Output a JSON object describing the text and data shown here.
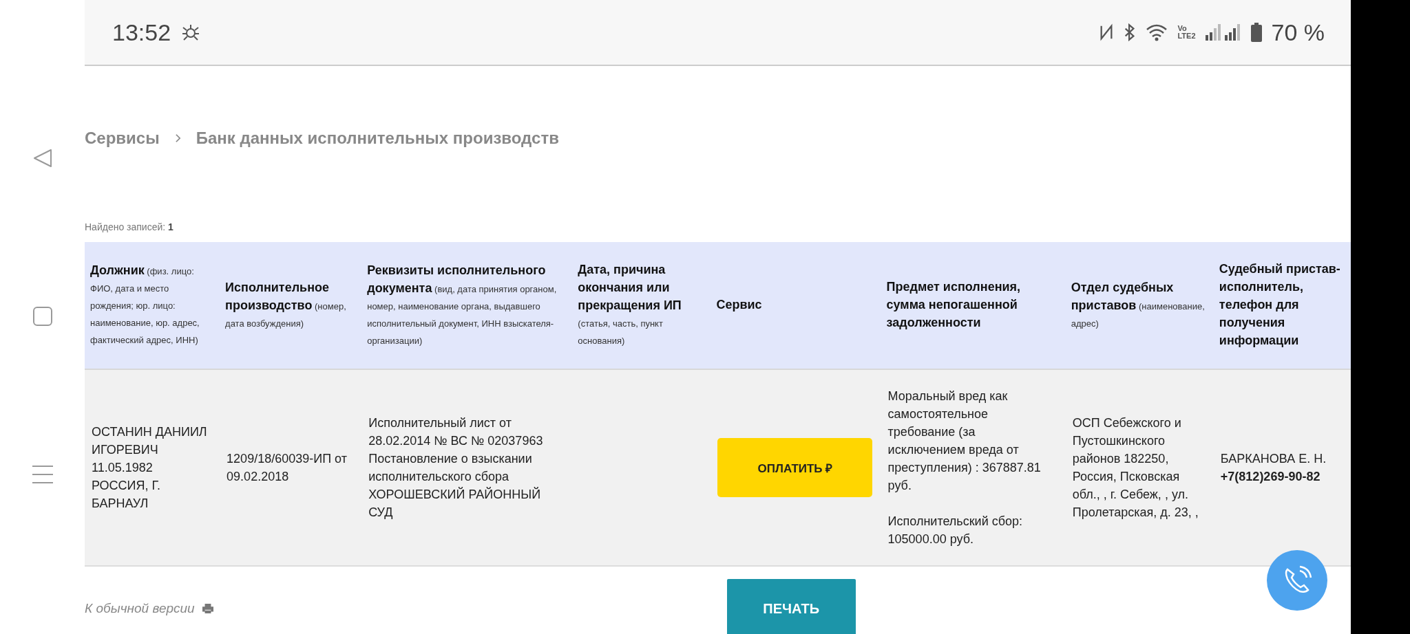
{
  "status_bar": {
    "time": "13:52",
    "volte": [
      "Vo",
      "LTE2"
    ],
    "battery": "70 %"
  },
  "breadcrumbs": [
    {
      "label": "Сервисы"
    },
    {
      "label": "Банк данных исполнительных производств"
    }
  ],
  "records_found": {
    "label": "Найдено записей:",
    "count": "1"
  },
  "table": {
    "columns": [
      {
        "header": "**Должник** (физ. лицо: ФИО, дата и место рождения; юр. лицо: наименование, юр. адрес, фактический адрес, ИНН)"
      },
      {
        "header": "**Исполнительное производство** (номер, дата возбуждения)"
      },
      {
        "header": "**Реквизиты исполнительного документа** (вид, дата принятия органом, номер, наименование органа, выдавшего исполнительный документ, ИНН взыскателя-организации)"
      },
      {
        "header": "**Дата, причина окончания или прекращения ИП** (статья, часть, пункт основания)"
      },
      {
        "header": "**Сервис**"
      },
      {
        "header": "**Предмет исполнения, сумма непогашенной задолженности**"
      },
      {
        "header": "**Отдел судебных приставов** (наименование, адрес)"
      },
      {
        "header": "**Судебный пристав-исполнитель, телефон для получения информации**"
      }
    ],
    "rows": [
      {
        "cells": [
          {
            "kind": "text",
            "paragraphs": [
              "ОСТАНИН ДАНИИЛ ИГОРЕВИЧ 11.05.1982 РОССИЯ, Г. БАРНАУЛ"
            ]
          },
          {
            "kind": "text",
            "paragraphs": [
              "1209/18/60039-ИП от 09.02.2018"
            ]
          },
          {
            "kind": "text",
            "paragraphs": [
              "Исполнительный лист от 28.02.2014 № ВС № 02037963 Постановление о взыскании исполнительского сбора ХОРОШЕВСКИЙ РАЙОННЫЙ СУД"
            ]
          },
          {
            "kind": "empty"
          },
          {
            "kind": "button",
            "label": "ОПЛАТИТЬ ₽"
          },
          {
            "kind": "text",
            "paragraphs": [
              "Моральный вред как самостоятельное требование (за исключением вреда от преступления) : 367887.81 руб.",
              "Исполнительский сбор: 105000.00 руб."
            ]
          },
          {
            "kind": "text",
            "paragraphs": [
              "ОСП Себежского и Пустошкинского районов 182250, Россия, Псковская обл., , г. Себеж, , ул. Пролетарская, д. 23, ,"
            ]
          },
          {
            "kind": "text",
            "paragraphs": [
              "БАРКАНОВА Е. Н. **+7(812)269-90-82**"
            ]
          }
        ]
      }
    ]
  },
  "footer": {
    "link": "К обычной версии",
    "print_button": "ПЕЧАТЬ"
  }
}
